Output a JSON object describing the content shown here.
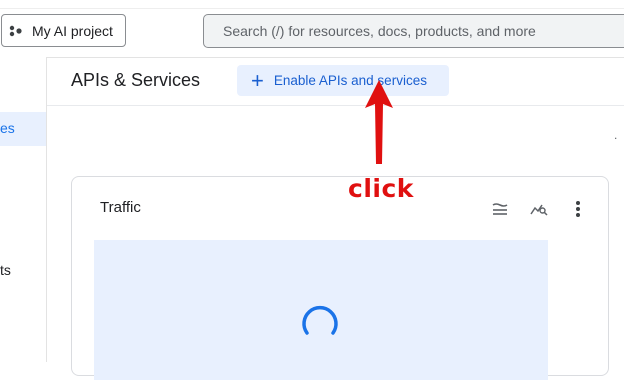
{
  "project": {
    "label": "My AI project",
    "icon": "project-dots-icon"
  },
  "search": {
    "placeholder": "Search (/) for resources, docs, products, and more"
  },
  "sidebar": {
    "items": [
      {
        "label": "es",
        "active": true
      },
      {
        "label": "ts",
        "active": false
      }
    ]
  },
  "header": {
    "title": "APIs & Services",
    "enable_button": "Enable APIs and services",
    "enable_icon": "plus-icon"
  },
  "card": {
    "title": "Traffic",
    "tools": [
      "legend-toggle-icon",
      "explore-chart-icon",
      "more-vert-icon"
    ],
    "status": "loading-spinner"
  },
  "annotation": {
    "text": "click",
    "color": "#e01010"
  },
  "edge_mark": "."
}
